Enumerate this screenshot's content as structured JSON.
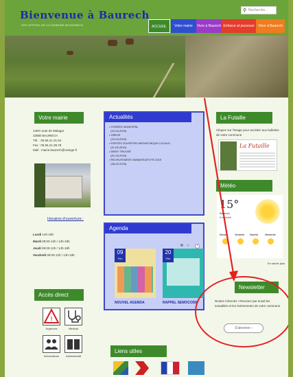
{
  "site": {
    "title": "Bienvenue à Baurech",
    "subtitle": "SITE OFFICIEL DE LA COMMUNE DE BAURECH",
    "search_placeholder": "Recherche..."
  },
  "nav": [
    {
      "label": "ACCUEIL",
      "color": "#3e8a2b"
    },
    {
      "label": "Votre mairie",
      "color": "#2f4fd0"
    },
    {
      "label": "Vivre à Baurech",
      "color": "#9b3bc8"
    },
    {
      "label": "Enfance et jeunesse",
      "color": "#e53c2c"
    },
    {
      "label": "Vivre à Baurech",
      "color": "#f07c1e"
    }
  ],
  "mairie": {
    "title": "Votre mairie",
    "address1": "1400 route de Malagar",
    "address2": "33880 BAURECH",
    "tel": "Tél. : 05.56.21.31.54",
    "fax": "Fax : 05.56.21.39.78",
    "mail": "Mail : mairie.baurech@orange.fr",
    "hours_link": "Horaires d'ouverture :",
    "hours": [
      {
        "day": "Lundi",
        "time": "14h-18h"
      },
      {
        "day": "Mardi",
        "time": "09:00-12h / 14h-18h"
      },
      {
        "day": "Jeudi",
        "time": "09:00-12h / 14h-18h"
      },
      {
        "day": "Vendredi",
        "time": "09:00-12h / 14h-18h"
      }
    ]
  },
  "actualites": {
    "title": "Actualités",
    "items": [
      {
        "title": "CONSEIL MUNICIPAL",
        "date": "(10-04-2019)"
      },
      {
        "title": "GREVE",
        "date": "(19-03-2019)"
      },
      {
        "title": "PORTES OUVERTES MEDIATHEQUE LOCALE",
        "date": "(11-03-2019)"
      },
      {
        "title": "DEBIT TROUVÉ",
        "date": "(01-03-2019)"
      },
      {
        "title": "RECRUTEMENT ANIMATEUR ETE 2019",
        "date": "(26-02-2019)"
      }
    ]
  },
  "agenda": {
    "title": "Agenda",
    "cards": [
      {
        "day": "09",
        "month": "Fév",
        "label": "NOUVEL AGENDA"
      },
      {
        "day": "20",
        "month": "Fév",
        "label": "RAPPEL SEMOCODE"
      }
    ]
  },
  "futaille": {
    "title": "La Futaille",
    "text": "Cliquez sur l'image pour accéder aux bulletins de votre commune",
    "cover_title": "La Futaille"
  },
  "meteo": {
    "title": "Météo",
    "temp": "15°",
    "loc": "Baurech",
    "condition": "Ensoleillé",
    "days": [
      "Demain",
      "Vendredi",
      "Samedi",
      "Dimanche"
    ],
    "link": "En savoir plus"
  },
  "newsletter": {
    "title": "Newsletter",
    "text": "Restez informés ! Recevez par email les actualités et les événements de votre commune",
    "button": "S'abonner"
  },
  "acces": {
    "title": "Accès direct",
    "items": [
      "Urgences",
      "Médical",
      "Informations",
      "Administratif"
    ]
  },
  "liens": {
    "title": "Liens utiles"
  },
  "colors": {
    "green": "#3e8a2b",
    "blue": "#2f3bd0",
    "annotation_red": "#e32121"
  }
}
